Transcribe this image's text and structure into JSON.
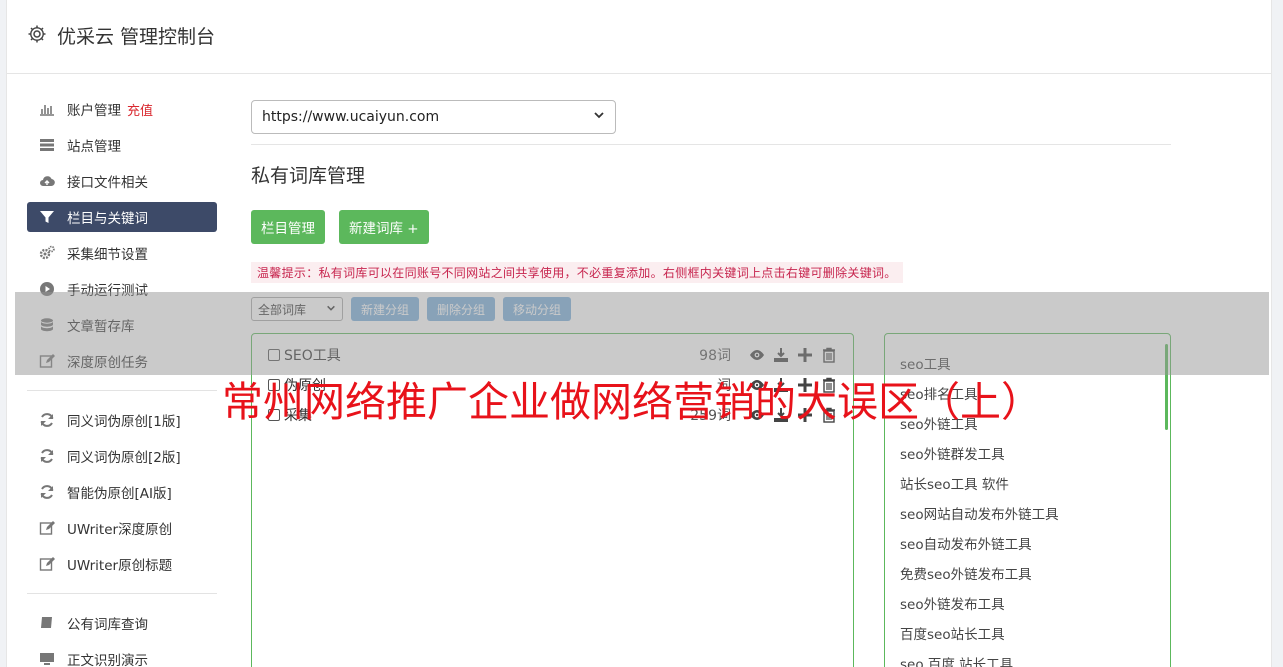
{
  "header": {
    "title": "优采云 管理控制台"
  },
  "sidebar": {
    "group1": [
      {
        "label": "账户管理",
        "badge": "充值",
        "icon": "bar-chart-icon"
      },
      {
        "label": "站点管理",
        "icon": "server-icon"
      },
      {
        "label": "接口文件相关",
        "icon": "cloud-upload-icon"
      },
      {
        "label": "栏目与关键词",
        "icon": "filter-icon",
        "active": true
      },
      {
        "label": "采集细节设置",
        "icon": "gears-icon"
      },
      {
        "label": "手动运行测试",
        "icon": "play-circle-icon"
      },
      {
        "label": "文章暂存库",
        "icon": "database-icon"
      },
      {
        "label": "深度原创任务",
        "icon": "edit-icon"
      }
    ],
    "group2": [
      {
        "label": "同义词伪原创[1版]",
        "icon": "refresh-icon"
      },
      {
        "label": "同义词伪原创[2版]",
        "icon": "refresh-icon"
      },
      {
        "label": "智能伪原创[AI版]",
        "icon": "refresh-icon"
      },
      {
        "label": "UWriter深度原创",
        "icon": "edit-icon"
      },
      {
        "label": "UWriter原创标题",
        "icon": "edit-icon"
      }
    ],
    "group3": [
      {
        "label": "公有词库查询",
        "icon": "book-icon"
      },
      {
        "label": "正文识别演示",
        "icon": "monitor-icon"
      }
    ]
  },
  "main": {
    "site_select": "https://www.ucaiyun.com",
    "section_title": "私有词库管理",
    "btn_column": "栏目管理",
    "btn_new_lib": "新建词库 +",
    "tip": "温馨提示：私有词库可以在同账号不同网站之间共享使用，不必重复添加。右侧框内关键词上点击右键可删除关键词。",
    "lib_filter": "全部词库",
    "btn_new_group": "新建分组",
    "btn_del_group": "删除分组",
    "btn_move_group": "移动分组",
    "libraries": [
      {
        "name": "SEO工具",
        "count": "98词"
      },
      {
        "name": "伪原创",
        "count": "词"
      },
      {
        "name": "采集",
        "count": "259词"
      }
    ],
    "keywords": [
      "seo工具",
      "seo排名工具",
      "seo外链工具",
      "seo外链群发工具",
      "站长seo工具 软件",
      "seo网站自动发布外链工具",
      "seo自动发布外链工具",
      "免费seo外链发布工具",
      "seo外链发布工具",
      "百度seo站长工具",
      "seo 百度 站长工具"
    ]
  },
  "overlay": {
    "title": "常州网络推广企业做网络营销的大误区（上）"
  },
  "colors": {
    "active_nav": "#3d4a68",
    "green": "#5cb85c",
    "blue": "#7aaedb",
    "red": "#e8121a"
  }
}
